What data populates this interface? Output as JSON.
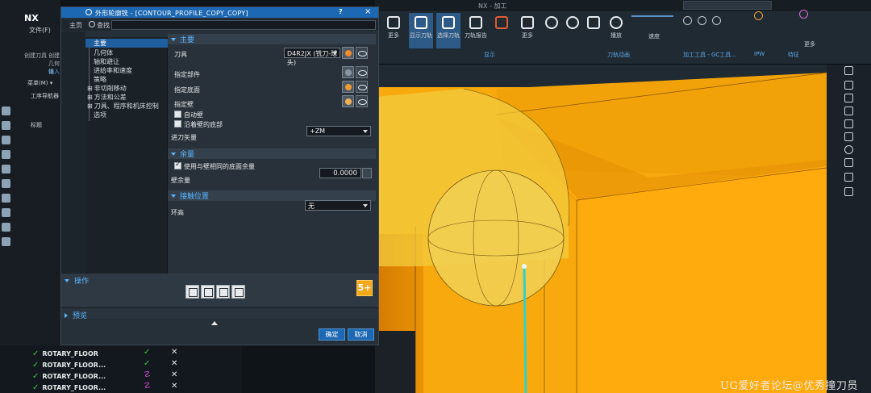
{
  "app": {
    "logo": "NX",
    "file_menu": "文件(F)",
    "home_tab": "主页",
    "window_title": "NX - 加工",
    "navigator_label": "工序导航器",
    "menu_label": "菜单(M) ▾",
    "create_tool": "创建刀具",
    "create_geometry": "创建几何体",
    "insert_label": "插入",
    "title_column": "标题"
  },
  "ribbon": {
    "buttons": [
      "更多",
      "显示刀轨",
      "选择刀轨",
      "刀轨报告",
      "更多",
      "播放",
      "速度",
      "更多"
    ],
    "group_labels": [
      "显示",
      "刀轨动画",
      "加工工具 - GC工具...",
      "IPW",
      "特征"
    ],
    "colors": {
      "highlight": "#2d5a86"
    }
  },
  "dialog": {
    "title": "外形轮廓铣 - [CONTOUR_PROFILE_COPY_COPY]",
    "help": "?",
    "close": "×",
    "home_tab": "主页",
    "find_label": "查找",
    "search_value": "",
    "tree": [
      {
        "label": "主要",
        "selected": true
      },
      {
        "label": "几何体"
      },
      {
        "label": "轴和避让"
      },
      {
        "label": "进给率和速度"
      },
      {
        "label": "策略"
      },
      {
        "label": "非切削移动"
      },
      {
        "label": "方法和公差"
      },
      {
        "label": "刀具、程序和机床控制"
      },
      {
        "label": "选项"
      }
    ],
    "main_section": {
      "header": "主要",
      "tool_label": "刀具",
      "tool_value": "D4R2JX (铣刀-球头)",
      "part_label": "指定部件",
      "floor_label": "指定底面",
      "wall_label": "指定壁",
      "auto_wall": "自动壁",
      "follow_floor": "沿着壁的底部",
      "tool_axis_label": "进刀矢量",
      "tool_axis_value": "+ZM"
    },
    "stock_section": {
      "header": "余量",
      "use_floor_stock": "使用与壁相同的底面余量",
      "wall_stock_label": "壁余量",
      "wall_stock_value": "0.0000"
    },
    "contact_section": {
      "header": "接触位置",
      "height_label": "环高",
      "height_value": "无"
    },
    "ops_header": "操作",
    "preview_header": "预览",
    "ok": "确定",
    "cancel": "取消"
  },
  "nav_tree": {
    "rows": [
      {
        "label": "ROTARY_FLOOR",
        "status": "ok",
        "mark": "x"
      },
      {
        "label": "ROTARY_FLOOR...",
        "status": "ok",
        "mark": "x"
      },
      {
        "label": "ROTARY_FLOOR...",
        "status": "warn",
        "mark": "x"
      },
      {
        "label": "ROTARY_FLOOR...",
        "status": "warn",
        "mark": "x"
      }
    ],
    "partial_labels": [
      "P",
      "P",
      "P",
      "P",
      "A",
      "Z",
      "F",
      "Z",
      "F",
      "V",
      "V"
    ]
  },
  "watermark": "UG爱好者论坛@优秀撞刀员"
}
